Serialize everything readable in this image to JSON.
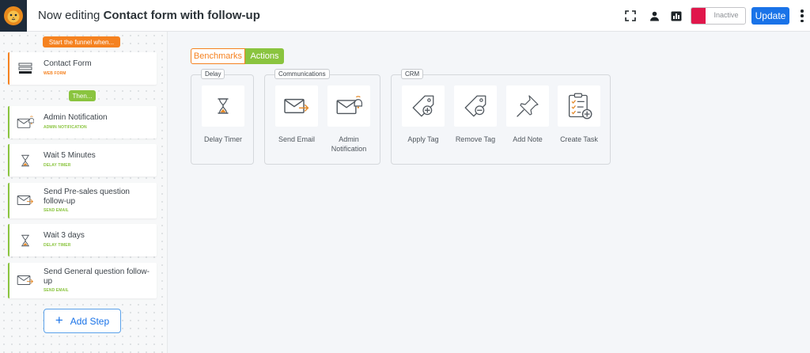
{
  "header": {
    "editing_prefix": "Now editing",
    "funnel_name": "Contact form with follow-up",
    "status_label": "Inactive",
    "update_label": "Update"
  },
  "sidebar": {
    "start_label": "Start the funnel when...",
    "then_label": "Then...",
    "benchmark": {
      "title": "Contact Form",
      "type": "WEB FORM"
    },
    "steps": [
      {
        "title": "Admin Notification",
        "type": "ADMIN NOTIFICATION",
        "icon": "envelope-bell-icon"
      },
      {
        "title": "Wait 5 Minutes",
        "type": "DELAY TIMER",
        "icon": "hourglass-icon"
      },
      {
        "title": "Send Pre-sales question follow-up",
        "type": "SEND EMAIL",
        "icon": "send-email-icon"
      },
      {
        "title": "Wait 3 days",
        "type": "DELAY TIMER",
        "icon": "hourglass-icon"
      },
      {
        "title": "Send General question follow-up",
        "type": "SEND EMAIL",
        "icon": "send-email-icon"
      }
    ],
    "add_step_label": "Add Step"
  },
  "panel": {
    "tabs": {
      "benchmarks": "Benchmarks",
      "actions": "Actions"
    },
    "groups": {
      "delay": {
        "label": "Delay",
        "items": [
          {
            "label": "Delay Timer",
            "icon": "hourglass-icon"
          }
        ]
      },
      "communications": {
        "label": "Communications",
        "items": [
          {
            "label": "Send Email",
            "icon": "send-email-icon"
          },
          {
            "label": "Admin Notification",
            "icon": "envelope-bell-icon"
          }
        ]
      },
      "crm": {
        "label": "CRM",
        "items": [
          {
            "label": "Apply Tag",
            "icon": "tag-plus-icon"
          },
          {
            "label": "Remove Tag",
            "icon": "tag-minus-icon"
          },
          {
            "label": "Add Note",
            "icon": "pushpin-icon"
          },
          {
            "label": "Create Task",
            "icon": "clipboard-checklist-icon"
          }
        ]
      }
    }
  },
  "colors": {
    "benchmark_orange": "#f58220",
    "action_green": "#8ac43f",
    "primary_blue": "#1a73e8",
    "inactive_red": "#e0174b"
  }
}
